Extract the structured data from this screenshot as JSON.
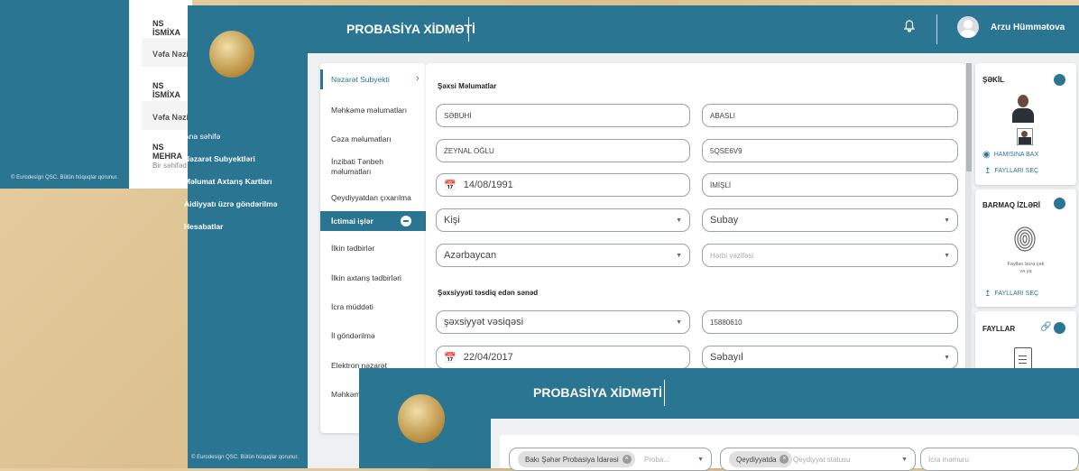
{
  "back": {
    "rows": [
      "NS İSMİXA",
      "Vəfa Nəzir",
      "NS İSMİXA",
      "Vəfa Nəzir",
      "NS MEHRA"
    ],
    "footer_text": "Bir səhifəd",
    "copyright": "© Eurodesign QSC. Bütün hüquqlar qorunur."
  },
  "app": {
    "title": "PROBASİYA XİDMƏTİ",
    "user_name": "Arzu Hümmətova",
    "copyright": "© Eurodesign QSC. Bütün hüquqlar qorunur.",
    "nav": [
      "Ana səhifə",
      "Nəzarət Subyektləri",
      "Məlumat Axtarış Kartları",
      "Aidiyyatı üzrə göndərilmə",
      "Hesabatlar"
    ]
  },
  "tabs": {
    "active": "Nəzarət Subyekti",
    "items": [
      "Məhkəmə məlumatları",
      "Cəza məlumatları",
      "İnzibati Tənbeh məlumatları",
      "Qeydiyyatdan çıxarılma"
    ],
    "social": "İctimai işlər",
    "items2": [
      "İlkin tədbirlər",
      "İlkin axtarış tədbirləri",
      "İcra müddəti",
      "İl göndərilmə",
      "Elektron nəzarət",
      "Məhkəm"
    ]
  },
  "form": {
    "personal_title": "Şəxsi Məlumatlar",
    "first_name": "SƏBUHİ",
    "last_name": "ABASLI",
    "patronymic": "ZEYNAL OĞLU",
    "fin": "5QSE6V9",
    "birth_date": "14/08/1991",
    "birth_place": "İMİŞLİ",
    "gender": "Kişi",
    "marital": "Subay",
    "citizenship": "Azərbaycan",
    "military_placeholder": "Hərbi vəzifəsi",
    "doc_title": "Şəxsiyyəti təsdiq edən sənəd",
    "doc_type": "şəxsiyyət vəsiqəsi",
    "doc_number": "15880610",
    "doc_date": "22/04/2017",
    "doc_issuer": "Səbayıl"
  },
  "right": {
    "photo_title": "ŞƏKİL",
    "view_all": "HAMISINA BAX",
    "choose_files": "FAYLLARI SEÇ",
    "finger_title": "BARMAQ İZLƏRİ",
    "drop_text": "Faylları bura çək",
    "drop_or": "və ya",
    "choose_files2": "FAYLLARI SEÇ",
    "files_title": "FAYLLAR"
  },
  "front": {
    "title": "PROBASİYA XİDMƏTİ",
    "filter1_chip": "Bakı Şəhər Probasiya İdarəsi",
    "filter1_placeholder": "Proba...",
    "filter2_chip": "Qeydiyyatda",
    "filter2_placeholder": "Qeydiyyat statusu",
    "filter3_placeholder": "İcra məmuru"
  }
}
